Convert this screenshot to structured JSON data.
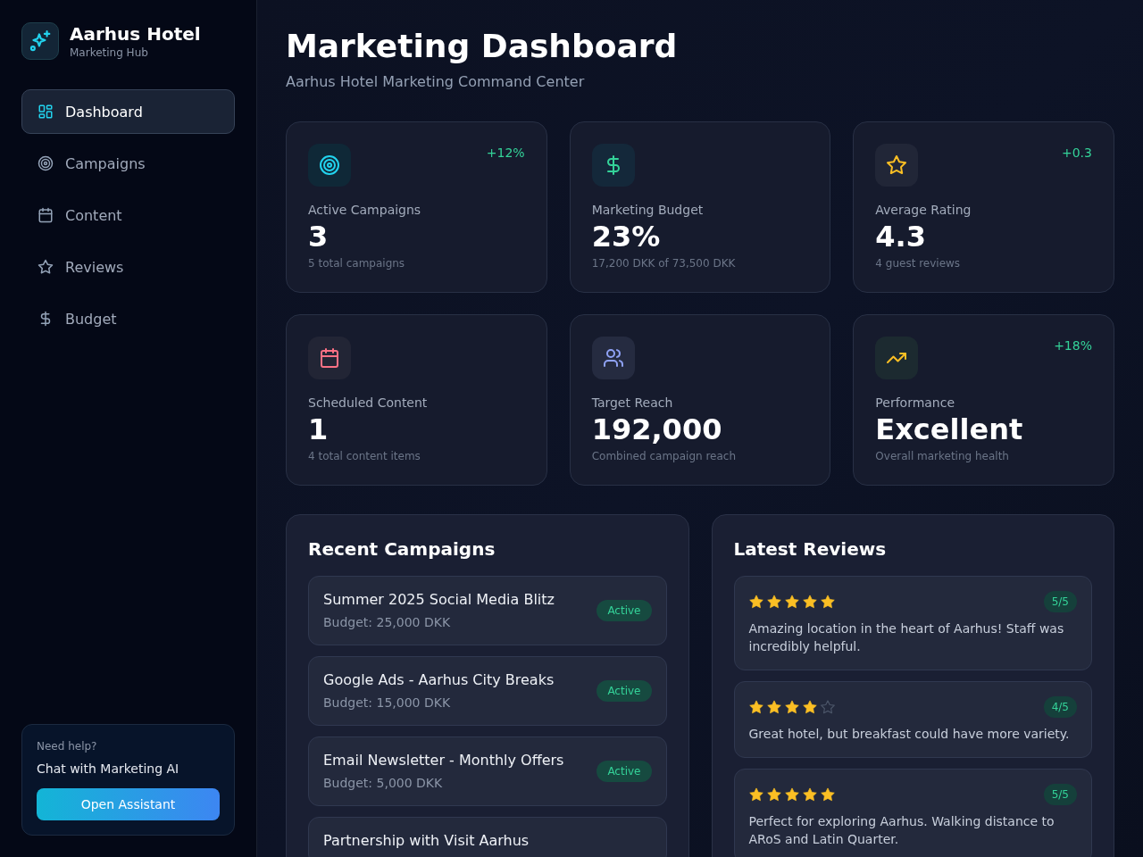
{
  "sidebar": {
    "brand": {
      "title": "Aarhus Hotel",
      "subtitle": "Marketing Hub"
    },
    "nav": [
      {
        "label": "Dashboard",
        "selected": true
      },
      {
        "label": "Campaigns",
        "selected": false
      },
      {
        "label": "Content",
        "selected": false
      },
      {
        "label": "Reviews",
        "selected": false
      },
      {
        "label": "Budget",
        "selected": false
      }
    ],
    "help": {
      "prompt": "Need help?",
      "text": "Chat with Marketing AI",
      "button": "Open Assistant"
    }
  },
  "header": {
    "title": "Marketing Dashboard",
    "subtitle": "Aarhus Hotel Marketing Command Center"
  },
  "stats": [
    {
      "label": "Active Campaigns",
      "value": "3",
      "note": "5 total campaigns",
      "trend": "+12%"
    },
    {
      "label": "Marketing Budget",
      "value": "23%",
      "note": "17,200 DKK of 73,500 DKK"
    },
    {
      "label": "Average Rating",
      "value": "4.3",
      "note": "4 guest reviews",
      "trend": "+0.3"
    },
    {
      "label": "Scheduled Content",
      "value": "1",
      "note": "4 total content items"
    },
    {
      "label": "Target Reach",
      "value": "192,000",
      "note": "Combined campaign reach"
    },
    {
      "label": "Performance",
      "value": "Excellent",
      "note": "Overall marketing health",
      "trend": "+18%"
    }
  ],
  "campaigns": {
    "title": "Recent Campaigns",
    "items": [
      {
        "name": "Summer 2025 Social Media Blitz",
        "budget": "Budget: 25,000 DKK",
        "status": "Active"
      },
      {
        "name": "Google Ads - Aarhus City Breaks",
        "budget": "Budget: 15,000 DKK",
        "status": "Active"
      },
      {
        "name": "Email Newsletter - Monthly Offers",
        "budget": "Budget: 5,000 DKK",
        "status": "Active"
      },
      {
        "name": "Partnership with Visit Aarhus"
      }
    ]
  },
  "reviews": {
    "title": "Latest Reviews",
    "items": [
      {
        "stars": 5,
        "score": "5/5",
        "text": "Amazing location in the heart of Aarhus! Staff was incredibly helpful."
      },
      {
        "stars": 4,
        "score": "4/5",
        "text": "Great hotel, but breakfast could have more variety."
      },
      {
        "stars": 5,
        "score": "5/5",
        "text": "Perfect for exploring Aarhus. Walking distance to ARoS and Latin Quarter."
      }
    ]
  }
}
